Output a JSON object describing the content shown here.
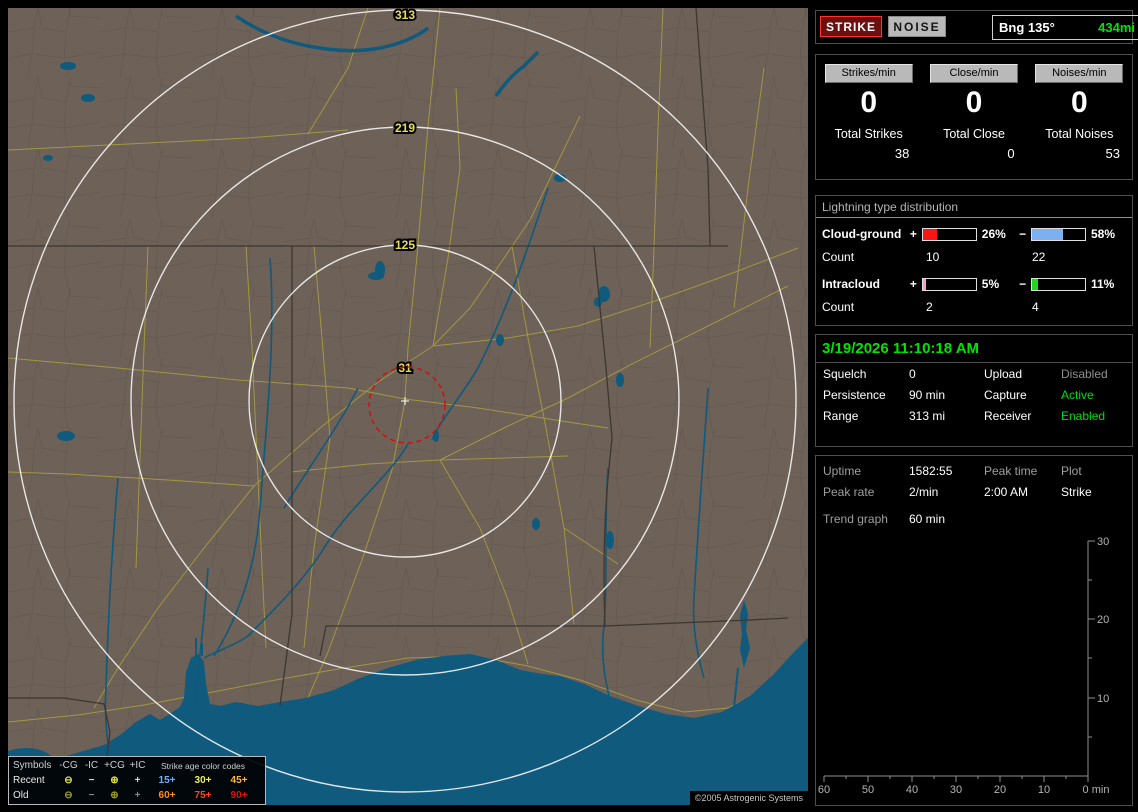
{
  "map": {
    "ring_labels": [
      "313",
      "219",
      "125",
      "31"
    ],
    "copyright": "©2005 Astrogenic Systems",
    "legend": {
      "symbols_header": "Symbols",
      "symbol_cols": [
        "-CG",
        "-IC",
        "+CG",
        "+IC"
      ],
      "age_header": "Strike age color codes",
      "symbols": [
        {
          "name": "neg-cg",
          "glyph": "⊖"
        },
        {
          "name": "neg-ic",
          "glyph": "−"
        },
        {
          "name": "pos-cg",
          "glyph": "⊕"
        },
        {
          "name": "pos-ic",
          "glyph": "+"
        }
      ],
      "rows": [
        {
          "label": "Recent",
          "ages": [
            "15+",
            "30+",
            "45+"
          ]
        },
        {
          "label": "Old",
          "ages": [
            "60+",
            "75+",
            "90+"
          ]
        }
      ]
    }
  },
  "panel": {
    "strike_button": "STRIKE",
    "noise_button": "NOISE",
    "bearing": {
      "label": "Bng 135°",
      "value": "434mi",
      "value_color": "#00e600"
    },
    "rates": [
      {
        "label": "Strikes/min",
        "value": "0",
        "total_label": "Total Strikes",
        "total_value": "38"
      },
      {
        "label": "Close/min",
        "value": "0",
        "total_label": "Total Close",
        "total_value": "0"
      },
      {
        "label": "Noises/min",
        "value": "0",
        "total_label": "Total Noises",
        "total_value": "53"
      }
    ],
    "distribution": {
      "title": "Lightning type distribution",
      "rows": [
        {
          "label": "Cloud-ground",
          "pos_sign": "+",
          "pos_pct": "26%",
          "pos_fill_style": "width:26%;background:#ff1414",
          "neg_sign": "−",
          "neg_pct": "58%",
          "neg_fill_style": "width:58%;background:#7db0f0",
          "count_label": "Count",
          "pos_count": "10",
          "neg_count": "22"
        },
        {
          "label": "Intracloud",
          "pos_sign": "+",
          "pos_pct": "5%",
          "pos_fill_style": "width:5%;background:#ff9ad5",
          "neg_sign": "−",
          "neg_pct": "11%",
          "neg_fill_style": "width:11%;background:#23d523",
          "count_label": "Count",
          "pos_count": "2",
          "neg_count": "4"
        }
      ]
    },
    "datetime": "3/19/2026 11:10:18 AM",
    "settings": {
      "rows": [
        {
          "k1": "Squelch",
          "v1": "0",
          "k2": "Upload",
          "v2": "Disabled"
        },
        {
          "k1": "Persistence",
          "v1": "90 min",
          "k2": "Capture",
          "v2": "Active"
        },
        {
          "k1": "Range",
          "v1": "313 mi",
          "k2": "Receiver",
          "v2": "Enabled"
        }
      ]
    },
    "stats": {
      "uptime_label": "Uptime",
      "uptime": "1582:55",
      "peak_time_label": "Peak time",
      "peak_time": "2:00 AM",
      "plot_label": "Plot",
      "plot_value": "Strike",
      "peak_rate_label": "Peak rate",
      "peak_rate": "2/min",
      "trend_label": "Trend graph",
      "trend_window": "60 min"
    }
  },
  "chart": {
    "type": "line",
    "title": "Trend graph",
    "x_labels": [
      "60",
      "50",
      "40",
      "30",
      "20",
      "10",
      "0 min"
    ],
    "y_labels": [
      "30",
      "20",
      "10"
    ],
    "x_range_minutes": [
      60,
      0
    ],
    "y_range": [
      0,
      30
    ],
    "series": [
      {
        "name": "Strike",
        "values": []
      }
    ]
  }
}
